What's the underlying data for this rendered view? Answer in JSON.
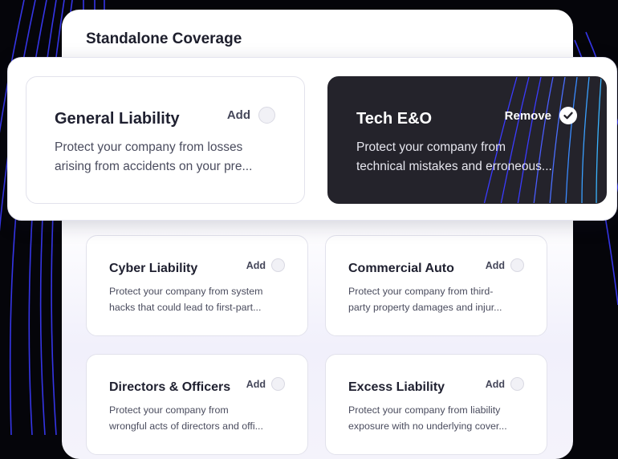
{
  "panel": {
    "title": "Standalone Coverage"
  },
  "featured": [
    {
      "title": "General Liability",
      "action": "Add",
      "selected": false,
      "desc_lines": [
        "Protect your company from losses",
        "arising from accidents on your pre..."
      ]
    },
    {
      "title": "Tech E&O",
      "action": "Remove",
      "selected": true,
      "desc_lines": [
        "Protect your company from",
        "technical mistakes and erroneous..."
      ]
    }
  ],
  "coverages": [
    {
      "title": "Cyber Liability",
      "action": "Add",
      "desc_lines": [
        "Protect your company from system",
        "hacks that could lead to first-part..."
      ]
    },
    {
      "title": "Commercial Auto",
      "action": "Add",
      "desc_lines": [
        "Protect your company from third-",
        "party property damages and injur..."
      ]
    },
    {
      "title": "Directors & Officers",
      "action": "Add",
      "desc_lines": [
        "Protect your company from",
        "wrongful acts of directors and offi..."
      ]
    },
    {
      "title": "Excess Liability",
      "action": "Add",
      "desc_lines": [
        "Protect your company from liability",
        "exposure with no underlying cover..."
      ]
    }
  ],
  "colors": {
    "accent_line": "#3b3bff",
    "dark_card": "#24232b",
    "accent_dark_line": "#3aa0ff"
  },
  "icons": {
    "selected": "check-icon",
    "unselected": "radio-circle-icon"
  }
}
